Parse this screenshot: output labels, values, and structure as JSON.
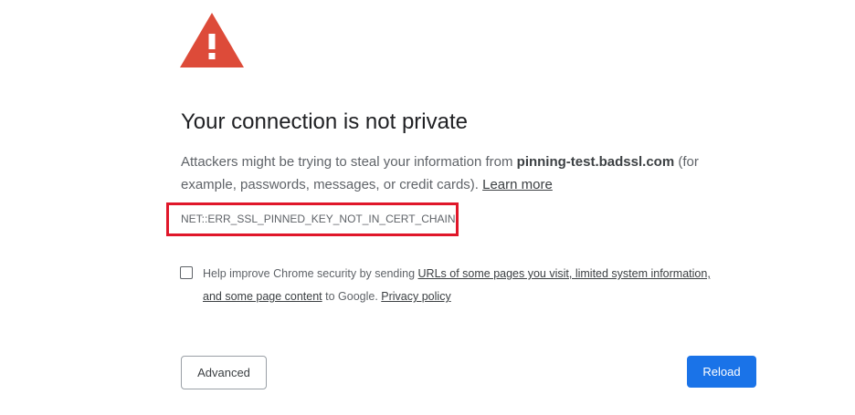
{
  "page": {
    "heading": "Your connection is not private",
    "explanation": {
      "before_host": "Attackers might be trying to steal your information from ",
      "host": "pinning-test.badssl.com",
      "after_host": " (for example, passwords, messages, or credit cards). ",
      "learn_more": "Learn more"
    },
    "error_code": "NET::ERR_SSL_PINNED_KEY_NOT_IN_CERT_CHAIN",
    "optin": {
      "before_link": "Help improve Chrome security by sending ",
      "link": "URLs of some pages you visit, limited system information, and some page content",
      "middle": " to Google. ",
      "privacy_link": "Privacy policy",
      "checked": false
    },
    "buttons": {
      "advanced": "Advanced",
      "reload": "Reload"
    },
    "colors": {
      "warning_icon": "#dd4b39",
      "highlight_box": "#e0172a",
      "primary_button": "#1a73e8"
    },
    "icons": {
      "warning": "warning-triangle-icon"
    }
  }
}
